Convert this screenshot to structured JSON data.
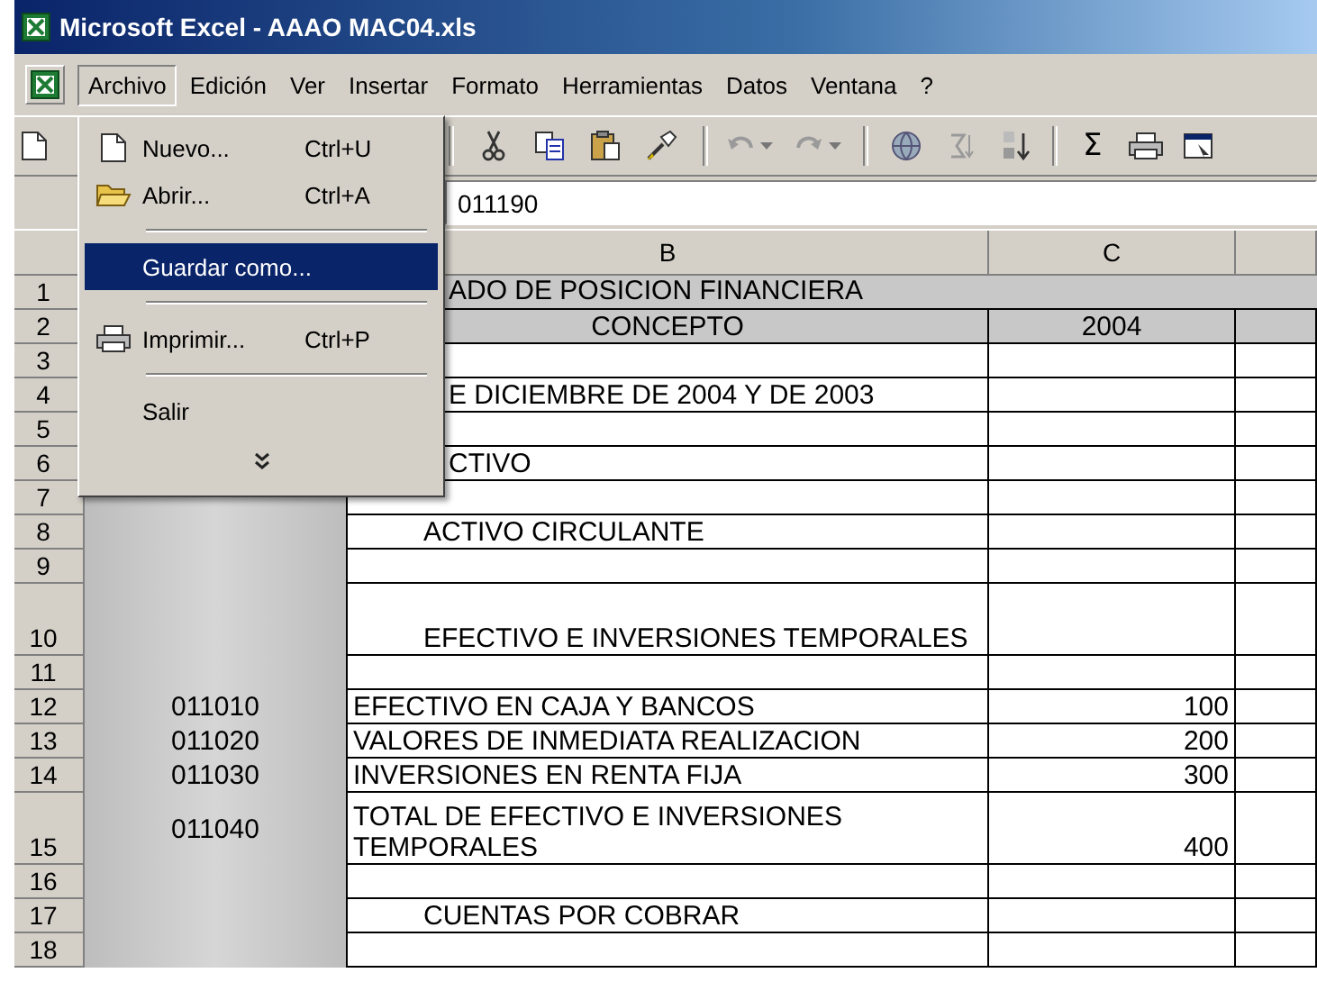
{
  "window": {
    "title": "Microsoft Excel - AAAO MAC04.xls"
  },
  "menu_bar": {
    "items": [
      {
        "label": "Archivo",
        "selected": true
      },
      {
        "label": "Edición",
        "selected": false
      },
      {
        "label": "Ver",
        "selected": false
      },
      {
        "label": "Insertar",
        "selected": false
      },
      {
        "label": "Formato",
        "selected": false
      },
      {
        "label": "Herramientas",
        "selected": false
      },
      {
        "label": "Datos",
        "selected": false
      },
      {
        "label": "Ventana",
        "selected": false
      },
      {
        "label": "?",
        "selected": false
      }
    ]
  },
  "toolbar": {
    "sum_label": "Σ"
  },
  "file_menu": {
    "items": [
      {
        "kind": "item",
        "label": "Nuevo...",
        "shortcut": "Ctrl+U",
        "selected": false
      },
      {
        "kind": "item",
        "label": "Abrir...",
        "shortcut": "Ctrl+A",
        "selected": false
      },
      {
        "kind": "separator"
      },
      {
        "kind": "item",
        "label": "Guardar como...",
        "selected": true
      },
      {
        "kind": "separator"
      },
      {
        "kind": "item",
        "label": "Imprimir...",
        "shortcut": "Ctrl+P",
        "selected": false
      },
      {
        "kind": "separator"
      },
      {
        "kind": "item",
        "label": "Salir",
        "selected": false
      },
      {
        "kind": "more"
      }
    ]
  },
  "formula_bar": {
    "value": "011190"
  },
  "sheet": {
    "column_headers": [
      "B",
      "C"
    ],
    "key_column_shaded": true,
    "rows": [
      {
        "number": "1",
        "kind": "banner",
        "b": "ADO DE POSICION FINANCIERA"
      },
      {
        "number": "2",
        "kind": "header",
        "b": "CONCEPTO",
        "c": "2004"
      },
      {
        "number": "3",
        "kind": "blank"
      },
      {
        "number": "4",
        "kind": "clipped",
        "b": "E DICIEMBRE DE  2004 Y DE 2003"
      },
      {
        "number": "5",
        "kind": "blank"
      },
      {
        "number": "6",
        "kind": "clipped",
        "b": "CTIVO"
      },
      {
        "number": "7",
        "kind": "blank"
      },
      {
        "number": "8",
        "kind": "section",
        "b": "ACTIVO CIRCULANTE"
      },
      {
        "number": "9",
        "kind": "blank"
      },
      {
        "number": "10",
        "kind": "section",
        "tall": true,
        "b": "EFECTIVO E INVERSIONES TEMPORALES"
      },
      {
        "number": "11",
        "kind": "blank"
      },
      {
        "number": "12",
        "kind": "entry",
        "a": "011010",
        "b": "EFECTIVO EN CAJA Y BANCOS",
        "c": "100"
      },
      {
        "number": "13",
        "kind": "entry",
        "a": "011020",
        "b": "VALORES DE INMEDIATA REALIZACION",
        "c": "200"
      },
      {
        "number": "14",
        "kind": "entry",
        "a": "011030",
        "b": "INVERSIONES EN RENTA FIJA",
        "c": "300"
      },
      {
        "number": "15",
        "kind": "entry",
        "tall": true,
        "a": "011040",
        "b": "TOTAL DE EFECTIVO E INVERSIONES TEMPORALES",
        "c": "400"
      },
      {
        "number": "16",
        "kind": "blank"
      },
      {
        "number": "17",
        "kind": "section",
        "b": "CUENTAS POR COBRAR"
      },
      {
        "number": "18",
        "kind": "blank"
      }
    ]
  }
}
